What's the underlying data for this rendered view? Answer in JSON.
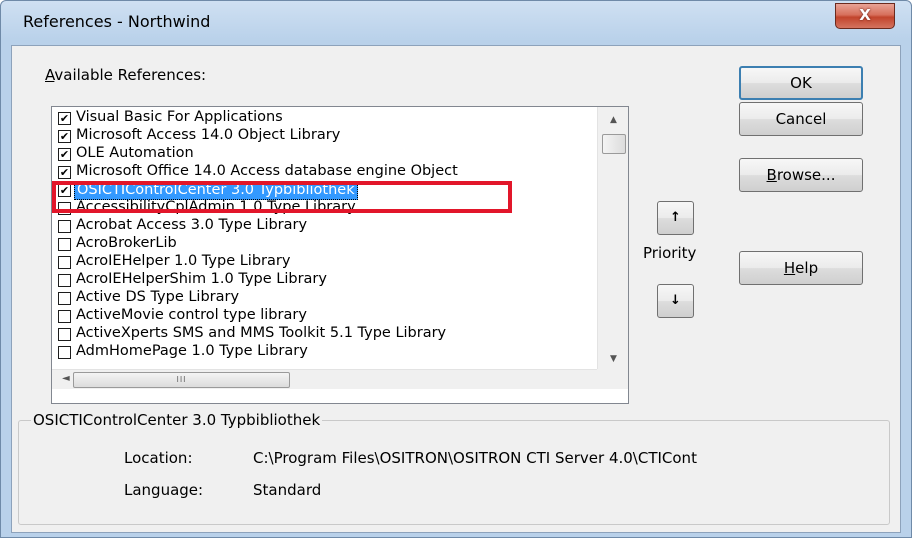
{
  "window": {
    "title": "References - Northwind",
    "close_glyph": "X"
  },
  "available_label": "Available References:",
  "references": [
    {
      "label": "Visual Basic For Applications",
      "checked": true
    },
    {
      "label": "Microsoft Access 14.0 Object Library",
      "checked": true
    },
    {
      "label": "OLE Automation",
      "checked": true
    },
    {
      "label": "Microsoft Office 14.0 Access database engine Object",
      "checked": true
    },
    {
      "label": "OSICTIControlCenter 3.0 Typbibliothek",
      "checked": true,
      "selected": true
    },
    {
      "label": "AccessibilityCplAdmin 1.0 Type Library",
      "checked": false
    },
    {
      "label": "Acrobat Access 3.0 Type Library",
      "checked": false
    },
    {
      "label": "AcroBrokerLib",
      "checked": false
    },
    {
      "label": "AcroIEHelper 1.0 Type Library",
      "checked": false
    },
    {
      "label": "AcroIEHelperShim 1.0 Type Library",
      "checked": false
    },
    {
      "label": "Active DS Type Library",
      "checked": false
    },
    {
      "label": "ActiveMovie control type library",
      "checked": false
    },
    {
      "label": "ActiveXperts SMS and MMS Toolkit 5.1 Type Library",
      "checked": false
    },
    {
      "label": "AdmHomePage 1.0 Type Library",
      "checked": false
    }
  ],
  "buttons": {
    "ok": "OK",
    "cancel": "Cancel",
    "browse": "Browse...",
    "help": "Help",
    "priority_up": "↑",
    "priority_down": "↓"
  },
  "priority_label": "Priority",
  "scrollbar_glyphs": {
    "up": "▲",
    "down": "▼",
    "left": "◄",
    "right": "►",
    "grip": "III"
  },
  "details": {
    "title": "OSICTIControlCenter 3.0 Typbibliothek",
    "location_label": "Location:",
    "location_value": "C:\\Program Files\\OSITRON\\OSITRON CTI Server 4.0\\CTICont",
    "language_label": "Language:",
    "language_value": "Standard"
  },
  "colors": {
    "selection": "#3399ff",
    "highlight_box": "#e2162a",
    "ok_border": "#3c7fb1"
  }
}
